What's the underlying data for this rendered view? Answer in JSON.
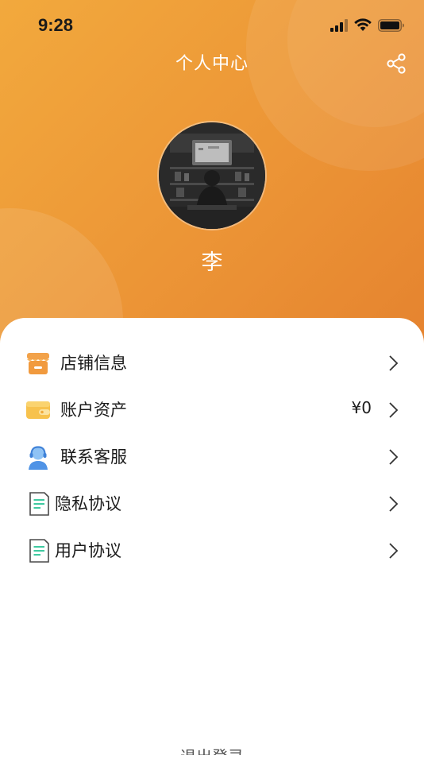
{
  "status_bar": {
    "time": "9:28"
  },
  "header": {
    "title": "个人中心",
    "share_icon": "share-icon",
    "background_from": "#f2a93d",
    "background_to": "#e5832f"
  },
  "profile": {
    "name": "李"
  },
  "menu": {
    "items": [
      {
        "label": "店铺信息",
        "icon": "store-icon",
        "value": ""
      },
      {
        "label": "账户资产",
        "icon": "wallet-icon",
        "value": "¥0"
      },
      {
        "label": "联系客服",
        "icon": "customer-service-icon",
        "value": ""
      },
      {
        "label": "隐私协议",
        "icon": "document-icon",
        "value": ""
      },
      {
        "label": "用户协议",
        "icon": "document-icon",
        "value": ""
      }
    ]
  },
  "footer": {
    "text": "退出登录"
  },
  "colors": {
    "accent": "#ee9535",
    "text": "#1c1c1c",
    "card": "#ffffff"
  }
}
